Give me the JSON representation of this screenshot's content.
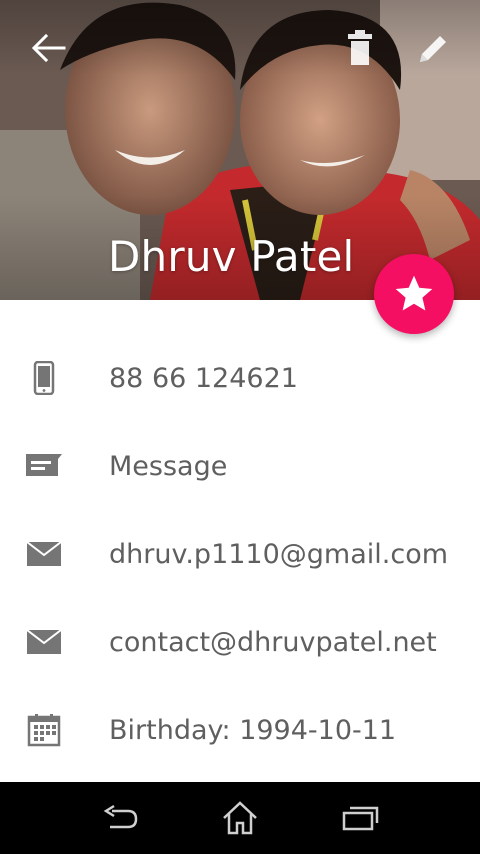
{
  "header": {
    "contact_name": "Dhruv Patel",
    "icons": [
      "back-arrow-icon",
      "trash-icon",
      "pencil-icon"
    ],
    "favorite_icon": "star-icon",
    "accent_color": "#f50f62"
  },
  "details": {
    "phone": {
      "icon": "mobile-phone-icon",
      "text": "88 66 124621"
    },
    "message": {
      "icon": "message-icon",
      "text": "Message"
    },
    "email_1": {
      "icon": "mail-icon",
      "text": "dhruv.p1110@gmail.com"
    },
    "email_2": {
      "icon": "mail-icon",
      "text": "contact@dhruvpatel.net"
    },
    "birthday": {
      "icon": "calendar-icon",
      "text": "Birthday: 1994-10-11"
    }
  },
  "navbar": {
    "icons": [
      "nav-back-icon",
      "nav-home-icon",
      "nav-recent-apps-icon"
    ]
  }
}
